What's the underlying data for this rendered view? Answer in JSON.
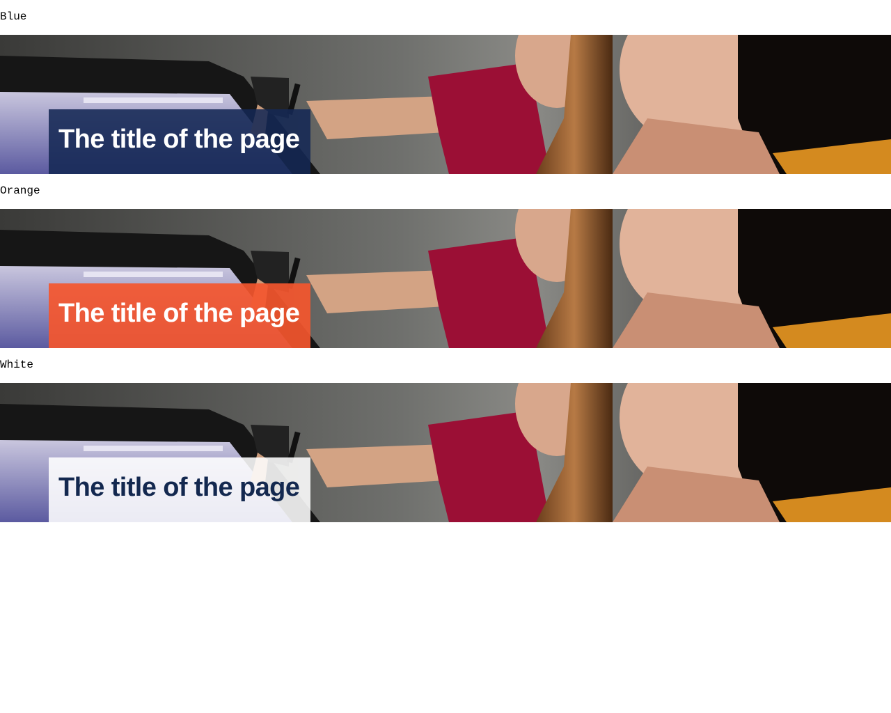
{
  "variants": [
    {
      "label": "Blue",
      "title": "The title of the page",
      "style": "blue",
      "box_color": "#142854",
      "text_color": "#ffffff"
    },
    {
      "label": "Orange",
      "title": "The title of the page",
      "style": "orange",
      "box_color": "#f4562e",
      "text_color": "#ffffff"
    },
    {
      "label": "White",
      "title": "The title of the page",
      "style": "white",
      "box_color": "#ffffff",
      "text_color": "#13284f"
    }
  ],
  "hero_image": "photo of two women looking at a drawing tablet screen"
}
